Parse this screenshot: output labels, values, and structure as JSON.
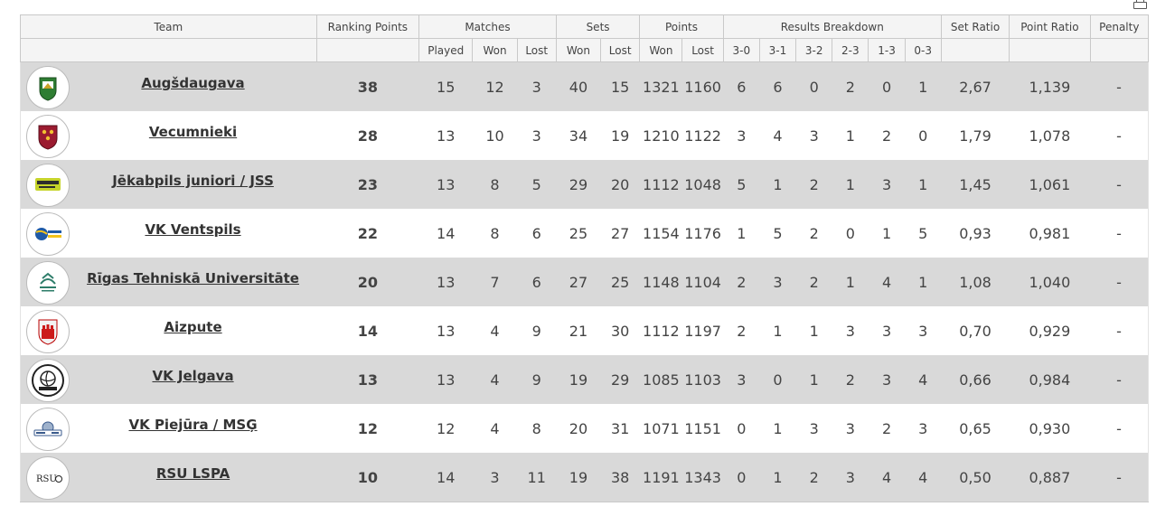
{
  "toolbar": {
    "print_icon": "printer-icon"
  },
  "headers": {
    "team": "Team",
    "ranking_points": "Ranking Points",
    "matches": "Matches",
    "sets": "Sets",
    "points": "Points",
    "results_breakdown": "Results Breakdown",
    "set_ratio": "Set Ratio",
    "point_ratio": "Point Ratio",
    "penalty": "Penalty",
    "played": "Played",
    "won": "Won",
    "lost": "Lost",
    "b30": "3-0",
    "b31": "3-1",
    "b32": "3-2",
    "b23": "2-3",
    "b13": "1-3",
    "b03": "0-3"
  },
  "rows": [
    {
      "team": "Augšdaugava",
      "logo": "augsdaugava-crest-icon",
      "rank": "38",
      "mp": "15",
      "mw": "12",
      "ml": "3",
      "sw": "40",
      "sl": "15",
      "pw": "1321",
      "pl": "1160",
      "b30": "6",
      "b31": "6",
      "b32": "0",
      "b23": "2",
      "b13": "0",
      "b03": "1",
      "sr": "2,67",
      "pr": "1,139",
      "pen": "-"
    },
    {
      "team": "Vecumnieki",
      "logo": "vecumnieki-crest-icon",
      "rank": "28",
      "mp": "13",
      "mw": "10",
      "ml": "3",
      "sw": "34",
      "sl": "19",
      "pw": "1210",
      "pl": "1122",
      "b30": "3",
      "b31": "4",
      "b32": "3",
      "b23": "1",
      "b13": "2",
      "b03": "0",
      "sr": "1,79",
      "pr": "1,078",
      "pen": "-"
    },
    {
      "team": "Jēkabpils juniori / JSS",
      "logo": "jekabpils-logo-icon",
      "rank": "23",
      "mp": "13",
      "mw": "8",
      "ml": "5",
      "sw": "29",
      "sl": "20",
      "pw": "1112",
      "pl": "1048",
      "b30": "5",
      "b31": "1",
      "b32": "2",
      "b23": "1",
      "b13": "3",
      "b03": "1",
      "sr": "1,45",
      "pr": "1,061",
      "pen": "-"
    },
    {
      "team": "VK Ventspils",
      "logo": "ventspils-logo-icon",
      "rank": "22",
      "mp": "14",
      "mw": "8",
      "ml": "6",
      "sw": "25",
      "sl": "27",
      "pw": "1154",
      "pl": "1176",
      "b30": "1",
      "b31": "5",
      "b32": "2",
      "b23": "0",
      "b13": "1",
      "b03": "5",
      "sr": "0,93",
      "pr": "0,981",
      "pen": "-"
    },
    {
      "team": "Rīgas Tehniskā Universitāte",
      "logo": "rtu-logo-icon",
      "rank": "20",
      "mp": "13",
      "mw": "7",
      "ml": "6",
      "sw": "27",
      "sl": "25",
      "pw": "1148",
      "pl": "1104",
      "b30": "2",
      "b31": "3",
      "b32": "2",
      "b23": "1",
      "b13": "4",
      "b03": "1",
      "sr": "1,08",
      "pr": "1,040",
      "pen": "-"
    },
    {
      "team": "Aizpute",
      "logo": "aizpute-crest-icon",
      "rank": "14",
      "mp": "13",
      "mw": "4",
      "ml": "9",
      "sw": "21",
      "sl": "30",
      "pw": "1112",
      "pl": "1197",
      "b30": "2",
      "b31": "1",
      "b32": "1",
      "b23": "3",
      "b13": "3",
      "b03": "3",
      "sr": "0,70",
      "pr": "0,929",
      "pen": "-"
    },
    {
      "team": "VK Jelgava",
      "logo": "jelgava-logo-icon",
      "rank": "13",
      "mp": "13",
      "mw": "4",
      "ml": "9",
      "sw": "19",
      "sl": "29",
      "pw": "1085",
      "pl": "1103",
      "b30": "3",
      "b31": "0",
      "b32": "1",
      "b23": "2",
      "b13": "3",
      "b03": "4",
      "sr": "0,66",
      "pr": "0,984",
      "pen": "-"
    },
    {
      "team": "VK Piejūra / MSĢ",
      "logo": "piejura-logo-icon",
      "rank": "12",
      "mp": "12",
      "mw": "4",
      "ml": "8",
      "sw": "20",
      "sl": "31",
      "pw": "1071",
      "pl": "1151",
      "b30": "0",
      "b31": "1",
      "b32": "3",
      "b23": "3",
      "b13": "2",
      "b03": "3",
      "sr": "0,65",
      "pr": "0,930",
      "pen": "-"
    },
    {
      "team": "RSU LSPA",
      "logo": "rsu-logo-icon",
      "rank": "10",
      "mp": "14",
      "mw": "3",
      "ml": "11",
      "sw": "19",
      "sl": "38",
      "pw": "1191",
      "pl": "1343",
      "b30": "0",
      "b31": "1",
      "b32": "2",
      "b23": "3",
      "b13": "4",
      "b03": "4",
      "sr": "0,50",
      "pr": "0,887",
      "pen": "-"
    }
  ],
  "logo_text": {
    "rsu": "RSU"
  }
}
